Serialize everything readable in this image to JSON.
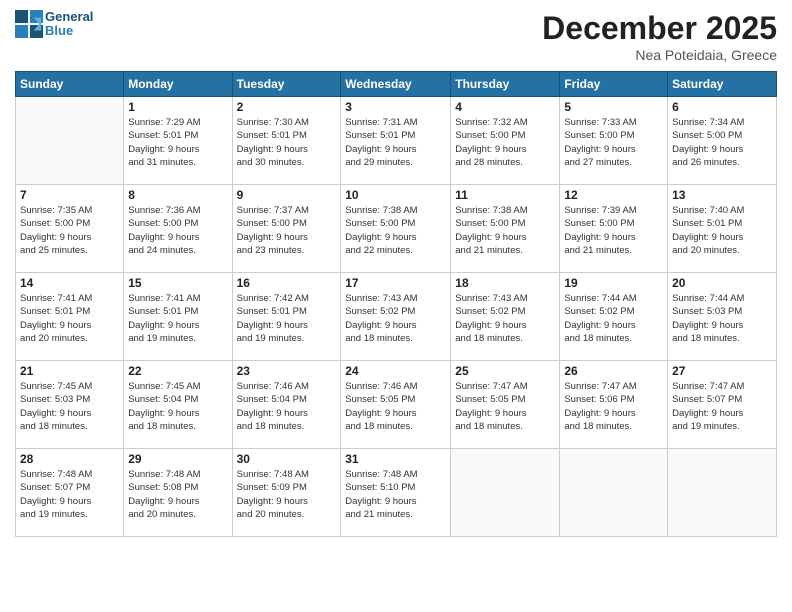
{
  "logo": {
    "text1": "General",
    "text2": "Blue"
  },
  "title": "December 2025",
  "location": "Nea Poteidaia, Greece",
  "days_header": [
    "Sunday",
    "Monday",
    "Tuesday",
    "Wednesday",
    "Thursday",
    "Friday",
    "Saturday"
  ],
  "weeks": [
    [
      {
        "day": "",
        "info": ""
      },
      {
        "day": "1",
        "info": "Sunrise: 7:29 AM\nSunset: 5:01 PM\nDaylight: 9 hours\nand 31 minutes."
      },
      {
        "day": "2",
        "info": "Sunrise: 7:30 AM\nSunset: 5:01 PM\nDaylight: 9 hours\nand 30 minutes."
      },
      {
        "day": "3",
        "info": "Sunrise: 7:31 AM\nSunset: 5:01 PM\nDaylight: 9 hours\nand 29 minutes."
      },
      {
        "day": "4",
        "info": "Sunrise: 7:32 AM\nSunset: 5:00 PM\nDaylight: 9 hours\nand 28 minutes."
      },
      {
        "day": "5",
        "info": "Sunrise: 7:33 AM\nSunset: 5:00 PM\nDaylight: 9 hours\nand 27 minutes."
      },
      {
        "day": "6",
        "info": "Sunrise: 7:34 AM\nSunset: 5:00 PM\nDaylight: 9 hours\nand 26 minutes."
      }
    ],
    [
      {
        "day": "7",
        "info": "Sunrise: 7:35 AM\nSunset: 5:00 PM\nDaylight: 9 hours\nand 25 minutes."
      },
      {
        "day": "8",
        "info": "Sunrise: 7:36 AM\nSunset: 5:00 PM\nDaylight: 9 hours\nand 24 minutes."
      },
      {
        "day": "9",
        "info": "Sunrise: 7:37 AM\nSunset: 5:00 PM\nDaylight: 9 hours\nand 23 minutes."
      },
      {
        "day": "10",
        "info": "Sunrise: 7:38 AM\nSunset: 5:00 PM\nDaylight: 9 hours\nand 22 minutes."
      },
      {
        "day": "11",
        "info": "Sunrise: 7:38 AM\nSunset: 5:00 PM\nDaylight: 9 hours\nand 21 minutes."
      },
      {
        "day": "12",
        "info": "Sunrise: 7:39 AM\nSunset: 5:00 PM\nDaylight: 9 hours\nand 21 minutes."
      },
      {
        "day": "13",
        "info": "Sunrise: 7:40 AM\nSunset: 5:01 PM\nDaylight: 9 hours\nand 20 minutes."
      }
    ],
    [
      {
        "day": "14",
        "info": "Sunrise: 7:41 AM\nSunset: 5:01 PM\nDaylight: 9 hours\nand 20 minutes."
      },
      {
        "day": "15",
        "info": "Sunrise: 7:41 AM\nSunset: 5:01 PM\nDaylight: 9 hours\nand 19 minutes."
      },
      {
        "day": "16",
        "info": "Sunrise: 7:42 AM\nSunset: 5:01 PM\nDaylight: 9 hours\nand 19 minutes."
      },
      {
        "day": "17",
        "info": "Sunrise: 7:43 AM\nSunset: 5:02 PM\nDaylight: 9 hours\nand 18 minutes."
      },
      {
        "day": "18",
        "info": "Sunrise: 7:43 AM\nSunset: 5:02 PM\nDaylight: 9 hours\nand 18 minutes."
      },
      {
        "day": "19",
        "info": "Sunrise: 7:44 AM\nSunset: 5:02 PM\nDaylight: 9 hours\nand 18 minutes."
      },
      {
        "day": "20",
        "info": "Sunrise: 7:44 AM\nSunset: 5:03 PM\nDaylight: 9 hours\nand 18 minutes."
      }
    ],
    [
      {
        "day": "21",
        "info": "Sunrise: 7:45 AM\nSunset: 5:03 PM\nDaylight: 9 hours\nand 18 minutes."
      },
      {
        "day": "22",
        "info": "Sunrise: 7:45 AM\nSunset: 5:04 PM\nDaylight: 9 hours\nand 18 minutes."
      },
      {
        "day": "23",
        "info": "Sunrise: 7:46 AM\nSunset: 5:04 PM\nDaylight: 9 hours\nand 18 minutes."
      },
      {
        "day": "24",
        "info": "Sunrise: 7:46 AM\nSunset: 5:05 PM\nDaylight: 9 hours\nand 18 minutes."
      },
      {
        "day": "25",
        "info": "Sunrise: 7:47 AM\nSunset: 5:05 PM\nDaylight: 9 hours\nand 18 minutes."
      },
      {
        "day": "26",
        "info": "Sunrise: 7:47 AM\nSunset: 5:06 PM\nDaylight: 9 hours\nand 18 minutes."
      },
      {
        "day": "27",
        "info": "Sunrise: 7:47 AM\nSunset: 5:07 PM\nDaylight: 9 hours\nand 19 minutes."
      }
    ],
    [
      {
        "day": "28",
        "info": "Sunrise: 7:48 AM\nSunset: 5:07 PM\nDaylight: 9 hours\nand 19 minutes."
      },
      {
        "day": "29",
        "info": "Sunrise: 7:48 AM\nSunset: 5:08 PM\nDaylight: 9 hours\nand 20 minutes."
      },
      {
        "day": "30",
        "info": "Sunrise: 7:48 AM\nSunset: 5:09 PM\nDaylight: 9 hours\nand 20 minutes."
      },
      {
        "day": "31",
        "info": "Sunrise: 7:48 AM\nSunset: 5:10 PM\nDaylight: 9 hours\nand 21 minutes."
      },
      {
        "day": "",
        "info": ""
      },
      {
        "day": "",
        "info": ""
      },
      {
        "day": "",
        "info": ""
      }
    ]
  ]
}
